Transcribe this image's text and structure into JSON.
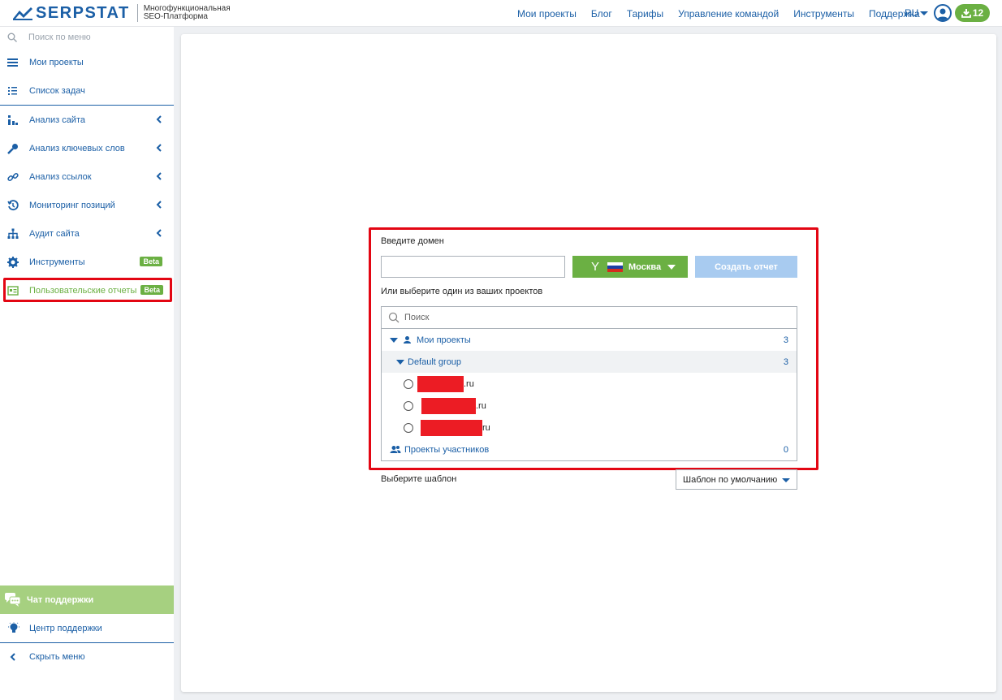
{
  "header": {
    "logo_text": "SERPSTAT",
    "logo_sub_1": "Многофункциональная",
    "logo_sub_2": "SEO-Платформа",
    "nav": [
      "Мои проекты",
      "Блог",
      "Тарифы",
      "Управление командой",
      "Инструменты",
      "Поддержка"
    ],
    "lang": "RU",
    "downloads_count": "12",
    "accent_color": "#1b5fa6",
    "green_color": "#6bb043"
  },
  "sidebar": {
    "search_placeholder": "Поиск по меню",
    "items": [
      {
        "label": "Мои проекты",
        "icon": "menu-icon"
      },
      {
        "label": "Список задач",
        "icon": "list-icon"
      },
      {
        "label": "Анализ сайта",
        "icon": "chart-icon"
      },
      {
        "label": "Анализ ключевых слов",
        "icon": "key-icon"
      },
      {
        "label": "Анализ ссылок",
        "icon": "link-icon"
      },
      {
        "label": "Мониторинг позиций",
        "icon": "history-icon"
      },
      {
        "label": "Аудит сайта",
        "icon": "sitemap-icon"
      },
      {
        "label": "Инструменты",
        "icon": "gear-icon",
        "badge": "Beta"
      },
      {
        "label": "Пользовательские отчеты",
        "icon": "report-icon",
        "badge": "Beta"
      }
    ],
    "chat_label": "Чат поддержки",
    "help_label": "Центр поддержки",
    "hide_label": "Скрыть меню"
  },
  "form": {
    "domain_label": "Введите домен",
    "domain_value": "",
    "search_engine_symbol": "Y",
    "region": "Москва",
    "create_button": "Создать отчет",
    "or_label": "Или выберите один из ваших проектов",
    "project_search_placeholder": "Поиск",
    "my_projects_label": "Мои проекты",
    "my_projects_count": "3",
    "group_label": "Default group",
    "group_count": "3",
    "domains": [
      ".ru",
      ".ru",
      "ru"
    ],
    "member_projects_label": "Проекты участников",
    "member_projects_count": "0",
    "template_label": "Выберите шаблон",
    "template_value": "Шаблон по умолчанию"
  }
}
